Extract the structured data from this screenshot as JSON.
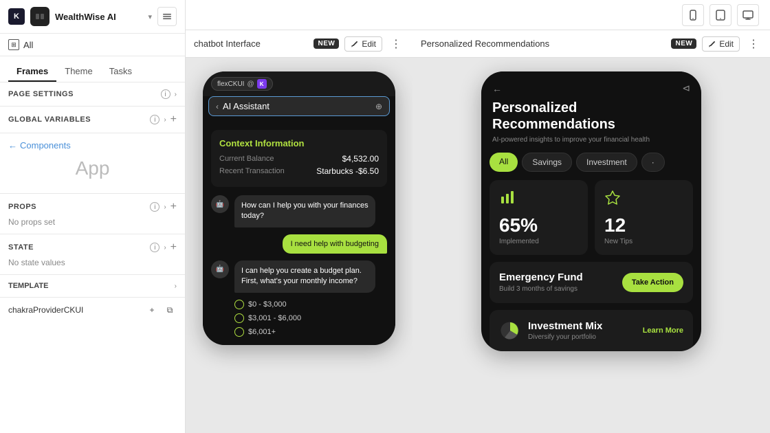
{
  "app": {
    "logo_text": "K",
    "title": "WealthWise AI",
    "title_arrow": "▾",
    "icon_btn_label": "□"
  },
  "topbar": {
    "device_icons": [
      "mobile",
      "tablet",
      "desktop"
    ]
  },
  "sidebar": {
    "all_label": "All",
    "tabs": [
      "Frames",
      "Theme",
      "Tasks"
    ],
    "active_tab": "Frames",
    "page_settings_label": "PAGE SETTINGS",
    "global_variables_label": "GLOBAL VARIABLES",
    "components_back": "Components",
    "app_label": "App",
    "props_label": "PROPS",
    "props_info": "i",
    "no_props": "No props set",
    "state_label": "STATE",
    "state_info": "i",
    "no_state": "No state values",
    "template_label": "TEMPLATE",
    "chakra_label": "chakraProviderCKUI"
  },
  "chatbot_frame": {
    "title": "chatbot Interface",
    "badge": "NEW",
    "edit_label": "Edit",
    "flex_ckui_label": "flexCKUI",
    "k_badge": "K",
    "assistant_title": "AI Assistant",
    "context_title": "Context Information",
    "balance_label": "Current Balance",
    "balance_value": "$4,532.00",
    "transaction_label": "Recent Transaction",
    "transaction_value": "Starbucks -$6.50",
    "bot_msg1": "How can I help you with your finances today?",
    "user_msg1": "I need help with budgeting",
    "bot_msg2": "I can help you create a budget plan. First, what's your monthly income?",
    "options": [
      "$0 - $3,000",
      "$3,001 - $6,000",
      "$6,001+"
    ]
  },
  "recommendations_frame": {
    "title": "Personalized Recommendations",
    "badge": "NEW",
    "edit_label": "Edit",
    "heading_line1": "Personalized",
    "heading_line2": "Recommendations",
    "subtitle": "AI-powered insights to improve your financial health",
    "tabs": [
      "All",
      "Savings",
      "Investment",
      "·"
    ],
    "active_tab": "All",
    "stat1_value": "65%",
    "stat1_label": "Implemented",
    "stat2_value": "12",
    "stat2_label": "New Tips",
    "emergency_title": "Emergency Fund",
    "emergency_desc": "Build 3 months of savings",
    "emergency_btn": "Take Action",
    "mix_title": "Investment Mix",
    "mix_desc": "Diversify your portfolio",
    "mix_btn": "Learn More"
  }
}
